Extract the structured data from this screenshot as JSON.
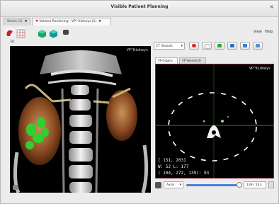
{
  "window": {
    "title": "Visible Patient Planning",
    "close_glyph": "×"
  },
  "tabs": [
    {
      "label": "Series (1)",
      "close": "✖"
    },
    {
      "label": "Volume Rendering - VP^Kidneys (1)",
      "close": "✖"
    }
  ],
  "toolbar": {
    "icons": [
      "kidney-red-icon",
      "mesh-grid-icon",
      "cube-green-icon",
      "cube-teal-icon",
      "camera-icon"
    ]
  },
  "menu": {
    "view": "View",
    "help": "Help"
  },
  "view3d": {
    "label": "3D",
    "tag": "VP^Kidneys"
  },
  "right": {
    "select_value": "CT Vessels",
    "subtabs": [
      "VP Organs",
      "VP Vessels(3)"
    ],
    "view2d_tag": "VP^Kidneys",
    "readout": {
      "line1": "[ 151, 203]",
      "line2": "W: 52 L: 177",
      "line3": "( 104, 272, 139): 93"
    },
    "plane": "Axial",
    "slice": "139 / 143",
    "slice_fraction": 0.97
  },
  "colors": {
    "accent": "#4a7fd1",
    "border2d": "#7a2a3a",
    "green_line": "#3fae3f"
  }
}
